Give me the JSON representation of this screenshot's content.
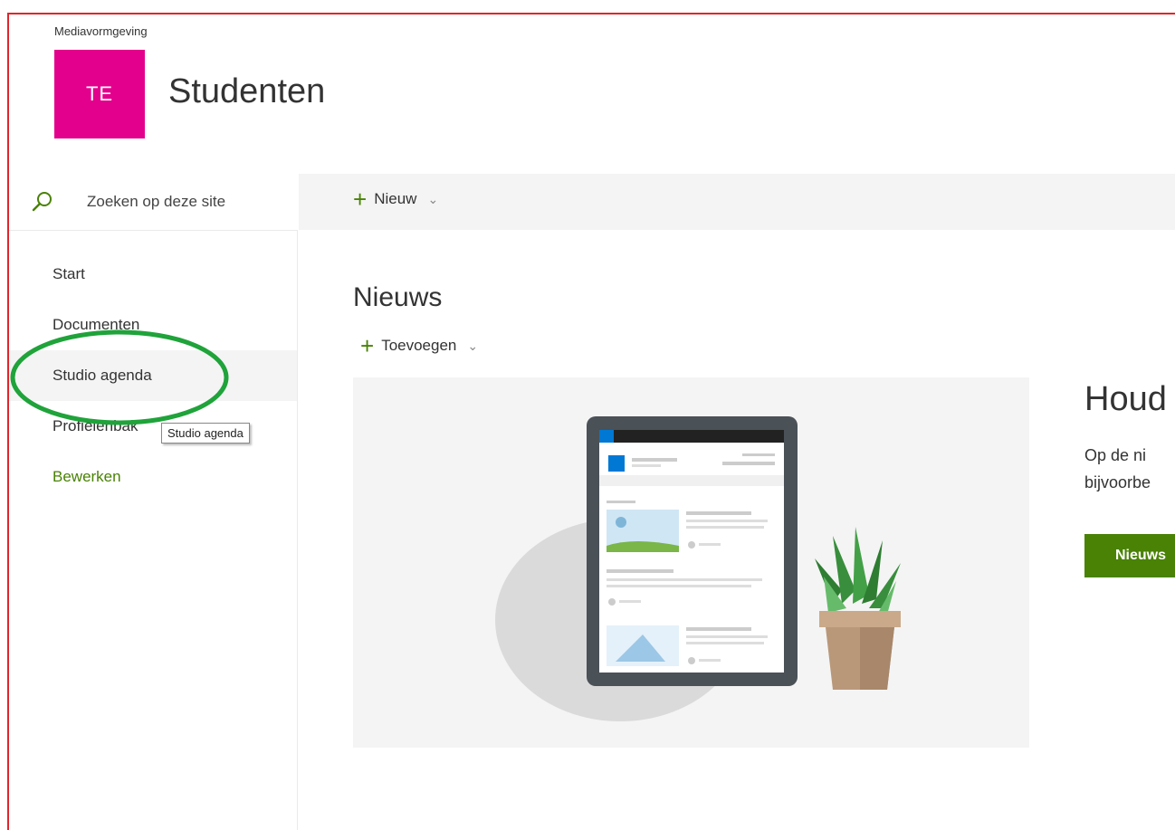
{
  "site": {
    "parent_label": "Mediavormgeving",
    "logo_initials": "TE",
    "title": "Studenten"
  },
  "search": {
    "placeholder": "Zoeken op deze site"
  },
  "commandbar": {
    "new_label": "Nieuw"
  },
  "nav": {
    "items": [
      {
        "label": "Start"
      },
      {
        "label": "Documenten"
      },
      {
        "label": "Studio agenda"
      },
      {
        "label": "Profielenbak"
      }
    ],
    "edit_label": "Bewerken",
    "tooltip": "Studio agenda"
  },
  "news": {
    "title": "Nieuws",
    "add_label": "Toevoegen",
    "promo_title": "Houd",
    "promo_line1": "Op de ni",
    "promo_line2": "bijvoorbe",
    "promo_button": "Nieuws"
  },
  "colors": {
    "brand_green": "#498205",
    "logo_bg": "#e3008c",
    "annotation_green": "#1fa33a",
    "frame_red": "#e0262a"
  }
}
